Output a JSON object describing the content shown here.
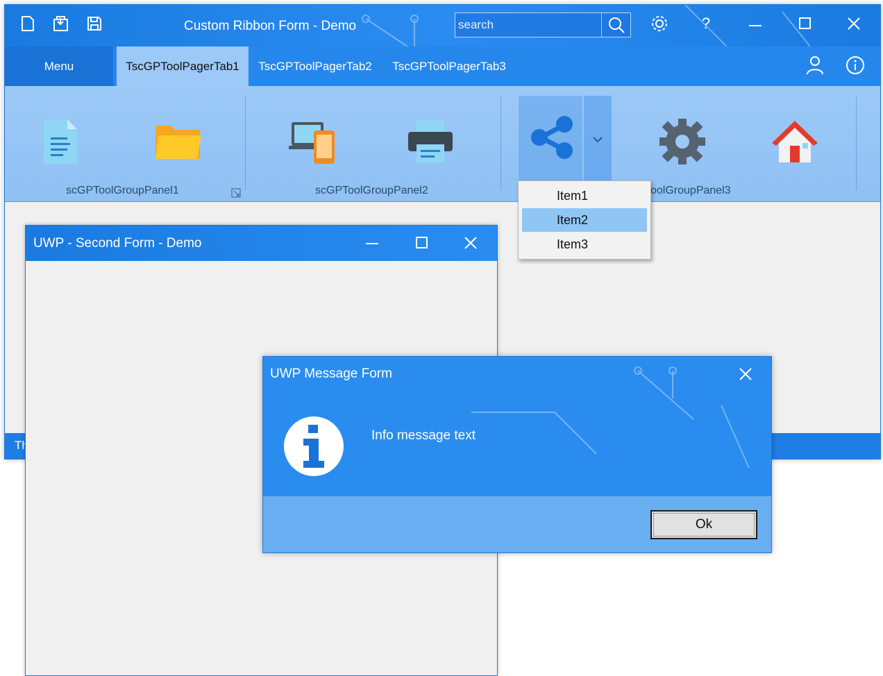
{
  "main_window": {
    "title": "Custom Ribbon Form - Demo",
    "search": {
      "placeholder": "search"
    },
    "tabs": [
      {
        "label": "Menu"
      },
      {
        "label": "TscGPToolPagerTab1"
      },
      {
        "label": "TscGPToolPagerTab2"
      },
      {
        "label": "TscGPToolPagerTab3"
      }
    ],
    "groups": [
      {
        "label": "scGPToolGroupPanel1"
      },
      {
        "label": "scGPToolGroupPanel2"
      },
      {
        "label": "oolGroupPanel3"
      }
    ],
    "status_text": "Th"
  },
  "dropdown": {
    "items": [
      {
        "label": "Item1"
      },
      {
        "label": "Item2"
      },
      {
        "label": "Item3"
      }
    ],
    "selected": "Item2"
  },
  "second_window": {
    "title": "UWP - Second Form - Demo"
  },
  "message_window": {
    "title": "UWP Message Form",
    "text": "Info message text",
    "ok_label": "Ok"
  },
  "colors": {
    "accent": "#1a7ae0",
    "ribbon": "#9cc9f7",
    "selected_item": "#90c6f4"
  }
}
